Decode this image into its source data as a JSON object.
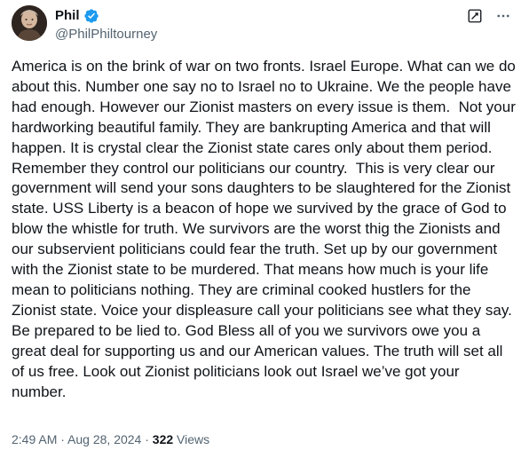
{
  "author": {
    "name": "Phil",
    "handle": "@PhilPhiltourney",
    "verified_icon": "verified-badge-icon",
    "verified_color": "#1d9bf0"
  },
  "actions": {
    "grok_icon": "grok-icon",
    "more_icon": "more-horizontal-icon"
  },
  "post": {
    "text": "America is on the brink of war on two fronts. Israel Europe. What can we do about this. Number one say no to Israel no to Ukraine. We the people have had enough. However our Zionist masters on every issue is them.  Not your  hardworking beautiful family. They are bankrupting America and that will happen. It is crystal clear the Zionist state cares only about them period. Remember they control our politicians our country.  This is very clear our government will send your sons daughters to be slaughtered for the Zionist state. USS Liberty is a beacon of hope we survived by the grace of God to blow the whistle for truth. We survivors are the worst thig the Zionists and our subservient politicians could fear the truth. Set up by our government with the Zionist state to be murdered. That means how much is your life mean to politicians nothing. They are criminal cooked hustlers for the Zionist state. Voice your displeasure call your politicians see what they say. Be prepared to be lied to. God Bless all of you we survivors owe you a great deal for supporting us and our American values. The truth will set all of us free. Look out Zionist politicians look out Israel we’ve got your number."
  },
  "meta": {
    "time": "2:49 AM",
    "separator": " · ",
    "date": "Aug 28, 2024",
    "views_count": "322",
    "views_label": " Views"
  }
}
